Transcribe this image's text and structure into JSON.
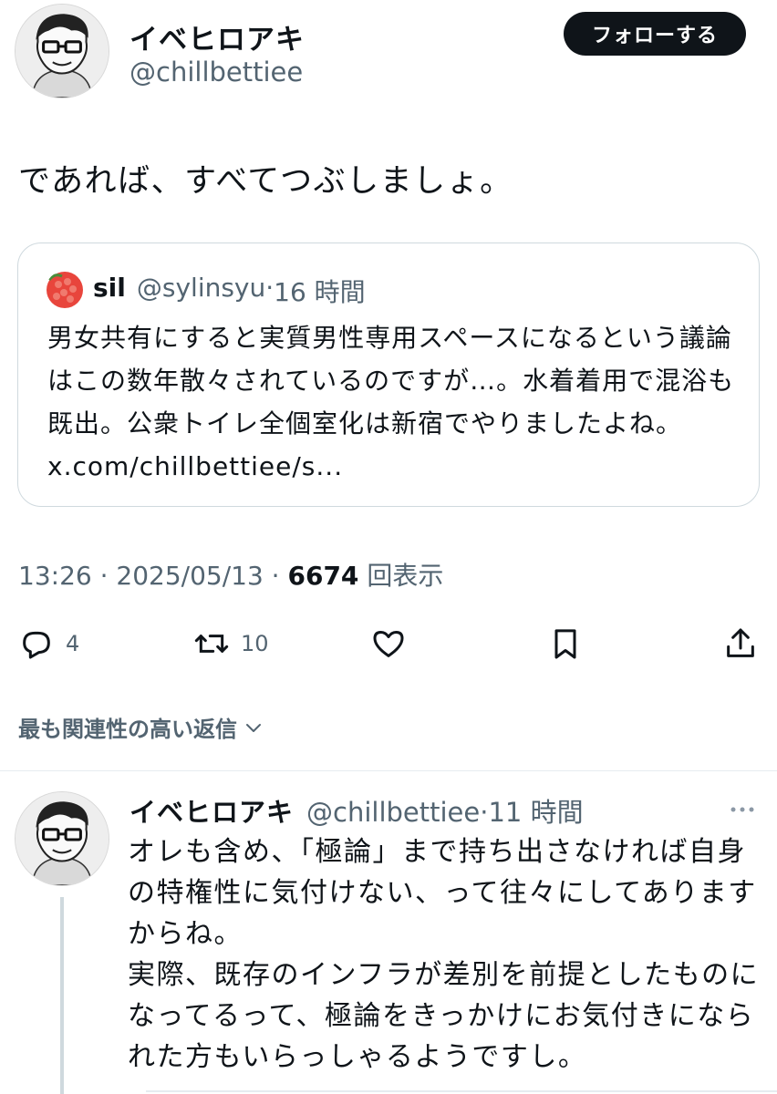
{
  "main_tweet": {
    "display_name": "イベヒロアキ",
    "handle": "@chillbettiee",
    "follow_label": "フォローする",
    "text": "であれば、すべてつぶしましょ。",
    "quote": {
      "display_name": "sil",
      "handle": "@sylinsyu",
      "separator": "·",
      "time": "16 時間",
      "text": "男女共有にすると実質男性専用スペースになるという議論はこの数年散々されているのですが…。水着着用で混浴も既出。公衆トイレ全個室化は新宿でやりましたよね。 x.com/chillbettiee/s..."
    },
    "timestamp": "13:26 · 2025/05/13 · ",
    "views_count": "6674",
    "views_label": " 回表示",
    "actions": {
      "reply_count": "4",
      "retweet_count": "10"
    }
  },
  "replies_sort_label": "最も関連性の高い返信",
  "reply": {
    "display_name": "イベヒロアキ",
    "handle": "@chillbettiee",
    "separator": "·",
    "time": "11 時間",
    "text": "オレも含め、「極論」まで持ち出さなければ自身の特権性に気付けない、って往々にしてありますからね。\n実際、既存のインフラが差別を前提としたものになってるって、極論をきっかけにお気付きになられた方もいらっしゃるようですし。"
  },
  "colors": {
    "text_primary": "#0f1419",
    "text_secondary": "#536471",
    "border": "#cfd9de"
  },
  "icons": [
    "reply-icon",
    "retweet-icon",
    "like-icon",
    "bookmark-icon",
    "share-icon",
    "chevron-down-icon",
    "more-icon"
  ]
}
